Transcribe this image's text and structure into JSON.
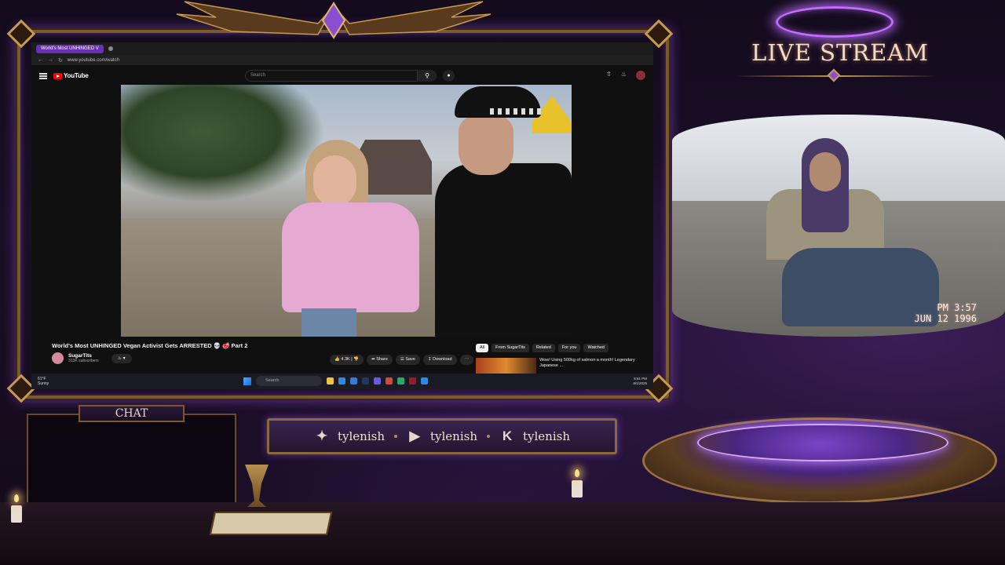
{
  "browser": {
    "tab_title": "World's Most UNHINGED V",
    "url": "www.youtube.com/watch",
    "search_placeholder": "Search"
  },
  "youtube": {
    "logo_text": "YouTube",
    "video_title": "World's Most UNHINGED Vegan Activist Gets ARRESTED 💀 🥩 Part 2",
    "channel_name": "SugarTits",
    "channel_subs": "313K subscribers",
    "actions": {
      "like_count": "4.3K",
      "share": "Share",
      "save": "Save",
      "download": "Download"
    },
    "chips": [
      "All",
      "From SugarTits",
      "Related",
      "For you",
      "Watched"
    ],
    "recommendation_title": "Wow! Using 500kg of salmon a month! Legendary Japanese ..."
  },
  "taskbar": {
    "weather_temp": "61°F",
    "weather_desc": "Sunny",
    "search_placeholder": "Search",
    "clock_time": "8:51 PM",
    "clock_date": "6/1/2025"
  },
  "overlay": {
    "live_title": "LIVE STREAM",
    "chat_label": "CHAT",
    "socials": [
      {
        "icon": "twitter-icon",
        "name": "tylenish"
      },
      {
        "icon": "youtube-icon",
        "name": "tylenish"
      },
      {
        "icon": "kick-icon",
        "name": "tylenish"
      }
    ]
  },
  "webcam": {
    "time_stamp": "PM 3:57",
    "date_stamp": "JUN 12 1996"
  },
  "colors": {
    "accent_purple": "#c46bff",
    "frame_gold": "#c79a4d",
    "youtube_red": "#ff0000"
  }
}
